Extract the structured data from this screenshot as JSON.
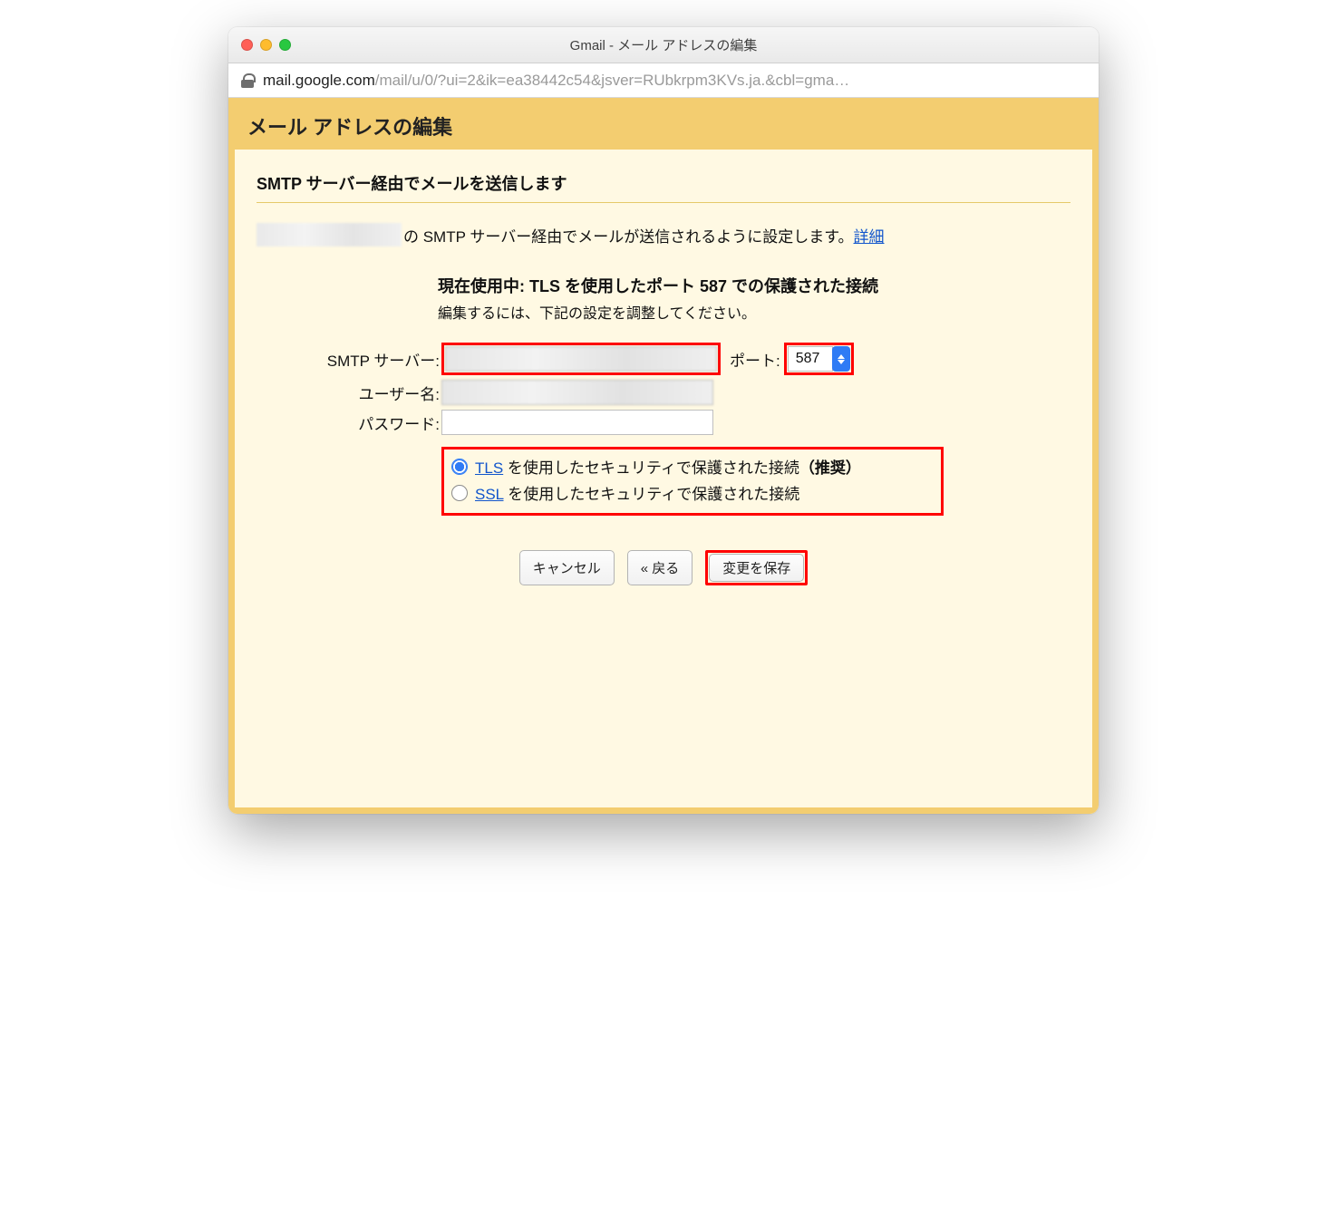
{
  "window": {
    "title": "Gmail - メール アドレスの編集"
  },
  "addressbar": {
    "host": "mail.google.com",
    "path": "/mail/u/0/?ui=2&ik=ea38442c54&jsver=RUbkrpm3KVs.ja.&cbl=gma…"
  },
  "page": {
    "header": "メール アドレスの編集",
    "section_title": "SMTP サーバー経由でメールを送信します",
    "intro_text": "の SMTP サーバー経由でメールが送信されるように設定します。",
    "detail_link": "詳細",
    "current_connection": "現在使用中: TLS を使用したポート 587 での保護された接続",
    "edit_instruction": "編集するには、下記の設定を調整してください。"
  },
  "form": {
    "smtp_label": "SMTP サーバー:",
    "port_label": "ポート:",
    "port_value": "587",
    "username_label": "ユーザー名:",
    "password_label": "パスワード:",
    "tls_link": "TLS",
    "tls_text": " を使用したセキュリティで保護された接続",
    "tls_suffix": "（推奨）",
    "ssl_link": "SSL",
    "ssl_text": " を使用したセキュリティで保護された接続"
  },
  "buttons": {
    "cancel": "キャンセル",
    "back": "« 戻る",
    "save": "変更を保存"
  }
}
